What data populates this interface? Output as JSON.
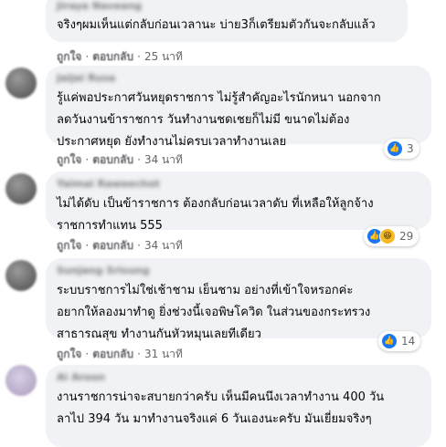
{
  "comments": [
    {
      "author": "Jiraya Naveang",
      "text": "จริงๆผมเห็นแต่กลับก่อนเวลานะ บ่าย3ก็เตรียมตัวกันจะกลับแล้ว",
      "like_label": "ถูกใจ",
      "reply_label": "ตอบกลับ",
      "time": "25 นาที",
      "reactions": null
    },
    {
      "author": "Jaijai Rusa",
      "text": "รู้แค่พอประกาศวันหยุดราชการ ไม่รู้สำคัญอะไรนักหนา นอกจาก\nลดวันงานข้าราชการ วันทำงานชดเชยก็ไม่มี ขนาดไม่ต้อง\nประกาศหยุด ยังทำงานไม่ครบเวลาทำงานเลย",
      "like_label": "ถูกใจ",
      "reply_label": "ตอบกลับ",
      "time": "34 นาที",
      "reactions": {
        "count": "3",
        "types": [
          "like-icon"
        ]
      }
    },
    {
      "author": "Yaimai Raweechot",
      "text": "ไม่ได้ดับ เป็นข้าราชการ ต้องกลับก่อนเวลาดับ ที่เหลือให้ลูกจ้าง\nราชการทำแทน 555",
      "like_label": "ถูกใจ",
      "reply_label": "ตอบกลับ",
      "time": "34 นาที",
      "reactions": {
        "count": "29",
        "types": [
          "like-icon",
          "haha-icon"
        ]
      }
    },
    {
      "author": "Sunjang Srisung",
      "text": "ระบบราชการไม่ใช่เช้าชาม เย็นชาม อย่างที่เข้าใจหรอกค่ะ\nอยากให้ลองมาทำดู ยิ่งช่วงนี้เจอพิษโควิด ในส่วนของกระทรวง\nสาธารณสุข ทำงานกันหัวหมุนเลยทีเดียว",
      "like_label": "ถูกใจ",
      "reply_label": "ตอบกลับ",
      "time": "31 นาที",
      "reactions": {
        "count": "14",
        "types": [
          "like-icon"
        ]
      }
    },
    {
      "author": "Ai Aroon",
      "text": "งานราชการน่าจะสบายกว่าครับ เห็นมีคนนึงเวลาทำงาน 400 วัน\nลาไป 394 วัน มาทำงานจริงแค่ 6 วันเองนะครับ มันเยี่ยมจริงๆ",
      "like_label": "",
      "reply_label": "",
      "time": "",
      "reactions": null
    }
  ]
}
